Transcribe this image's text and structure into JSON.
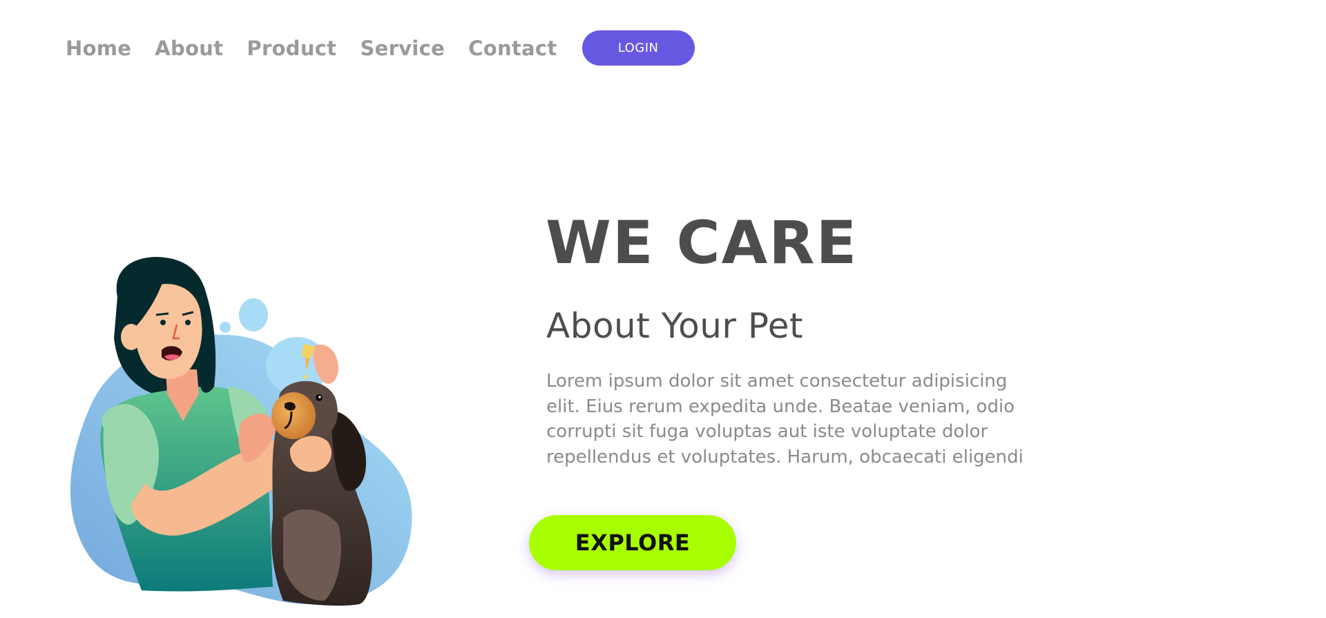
{
  "nav": {
    "items": [
      "Home",
      "About",
      "Product",
      "Service",
      "Contact"
    ],
    "login_label": "LOGIN"
  },
  "hero": {
    "title": "WE CARE",
    "subtitle": "About Your Pet",
    "text_lines": [
      "Lorem ipsum dolor sit amet consectetur adipisicing",
      "elit. Eius rerum expedita unde. Beatae veniam, odio",
      "corrupti sit fuga voluptas aut iste voluptate dolor",
      "repellendus et voluptates. Harum, obcaecati eligendi"
    ],
    "explore_label": "EXPLORE"
  },
  "colors": {
    "accent": "#6658e0",
    "cta": "#a8ff00",
    "heading": "#4d4d4d",
    "nav_text": "#9a9a9a"
  },
  "icons": {
    "illustration": "woman-with-dog-illustration"
  }
}
